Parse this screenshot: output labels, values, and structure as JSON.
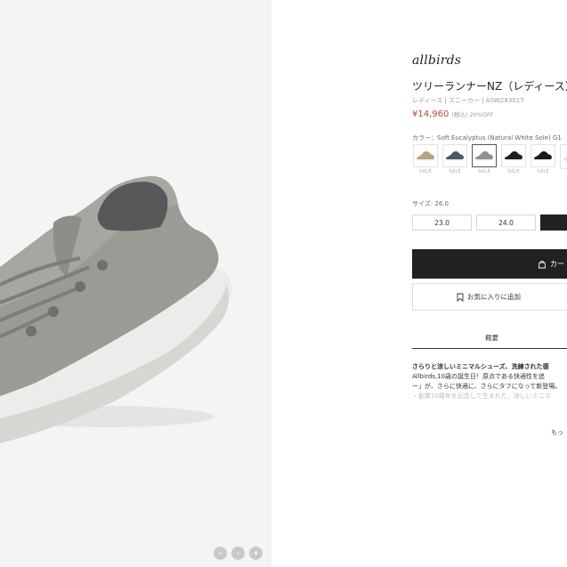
{
  "product_image": {
    "carousel_controls": [
      "‹",
      "›",
      "⏸"
    ]
  },
  "brand": {
    "logo_text": "allbirds"
  },
  "product": {
    "title": "ツリーランナーNZ（レディース）",
    "meta": "レディース | スニーカー | ASW283017",
    "price": "¥14,960",
    "price_note": "(税込)  20%OFF"
  },
  "color": {
    "label": "カラー：Soft Eucalyptus (Natural White Sole)  G1",
    "swatches": [
      {
        "name": "khaki",
        "sale": "SALE",
        "selected": false,
        "color": "#b5a47c"
      },
      {
        "name": "navy",
        "sale": "SALE",
        "selected": false,
        "color": "#4d5666"
      },
      {
        "name": "soft-eucalyptus",
        "sale": "SALE",
        "selected": true,
        "color": "#8f918c"
      },
      {
        "name": "black",
        "sale": "SALE",
        "selected": false,
        "color": "#1f1f1f"
      },
      {
        "name": "black-2",
        "sale": "SALE",
        "selected": false,
        "color": "#191919"
      },
      {
        "name": "white",
        "sale": "",
        "selected": false,
        "color": "#e3e3e3"
      }
    ]
  },
  "size": {
    "label": "サイズ: 26.0",
    "options": [
      {
        "label": "23.0",
        "selected": false
      },
      {
        "label": "24.0",
        "selected": false
      },
      {
        "label": "",
        "selected": true
      }
    ]
  },
  "actions": {
    "cart_label": "カー",
    "favorite_label": "お気に入りに追加"
  },
  "tabs": {
    "size_tab": "概要"
  },
  "description": {
    "headline": "さらりと涼しいミニマルシューズ、洗練された德",
    "line1": "Allbirds,10歳の誕生日！原点である快適性を追",
    "line2": "ー」が、さらに快適に、さらにタフになって新登場。",
    "line3": "・創業10周年を記念して生まれた、涼しいミニマ"
  },
  "more_link": "もっ"
}
